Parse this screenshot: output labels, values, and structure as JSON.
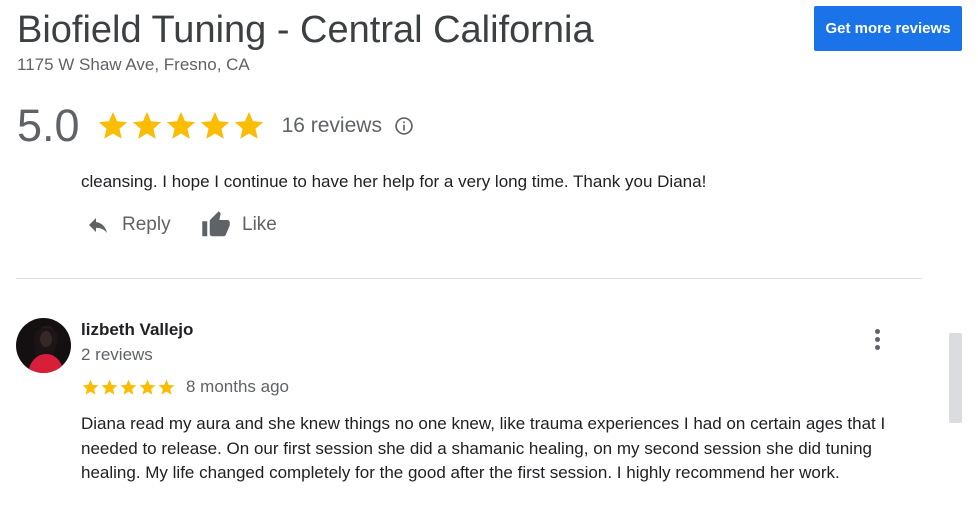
{
  "business": {
    "name": "Biofield Tuning - Central California",
    "address": "1175 W Shaw Ave, Fresno, CA"
  },
  "header": {
    "cta_label": "Get more reviews",
    "cta_color": "#1a73e8"
  },
  "summary": {
    "rating": "5.0",
    "stars": 5,
    "review_count_label": "16 reviews",
    "star_color": "#fbbc04",
    "info_icon": "info-icon"
  },
  "previous_review": {
    "text_tail": "cleansing. I hope I continue to have her help for a very long time. Thank you Diana!",
    "actions": {
      "reply_label": "Reply",
      "like_label": "Like"
    }
  },
  "review": {
    "author": "lizbeth Vallejo",
    "author_meta": "2 reviews",
    "stars": 5,
    "time": "8 months ago",
    "text": "Diana read my aura and she knew things no one knew, like trauma experiences I had on certain ages that I needed to release. On our first session she did a shamanic healing, on my second session she did tuning healing. My life changed completely for the good after the first session. I highly recommend her work."
  },
  "icons": {
    "reply": "reply-arrow-icon",
    "like": "thumbs-up-icon",
    "more": "more-vert-icon",
    "star": "star-icon",
    "avatar": "avatar"
  }
}
